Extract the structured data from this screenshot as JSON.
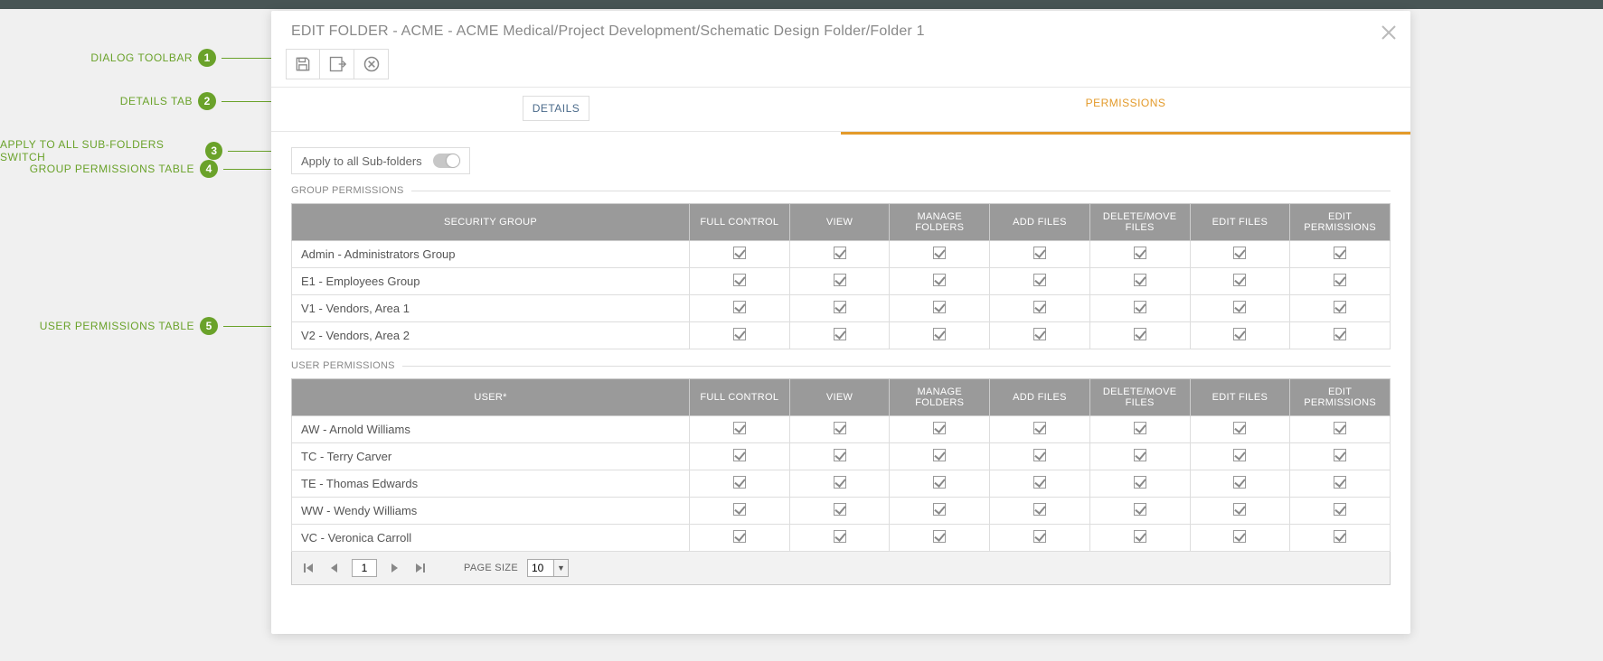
{
  "dialog": {
    "title": "EDIT FOLDER - ACME - ACME Medical/Project Development/Schematic Design Folder/Folder 1"
  },
  "tabs": {
    "details": "DETAILS",
    "permissions": "PERMISSIONS"
  },
  "apply_label": "Apply to all Sub-folders",
  "apply_value": false,
  "group_section": {
    "title": "GROUP PERMISSIONS",
    "name_col": "SECURITY GROUP"
  },
  "user_section": {
    "title": "USER PERMISSIONS",
    "name_col": "USER*"
  },
  "columns": {
    "full": "FULL CONTROL",
    "view": "VIEW",
    "manage": "MANAGE FOLDERS",
    "add": "ADD FILES",
    "del": "DELETE/MOVE FILES",
    "edit": "EDIT FILES",
    "perm": "EDIT PERMISSIONS"
  },
  "groups": [
    {
      "name": "Admin - Administrators Group",
      "full": true,
      "view": true,
      "manage": true,
      "add": true,
      "del": true,
      "edit": true,
      "perm": true
    },
    {
      "name": "E1 - Employees Group",
      "full": true,
      "view": true,
      "manage": true,
      "add": true,
      "del": true,
      "edit": true,
      "perm": true
    },
    {
      "name": "V1 - Vendors, Area 1",
      "full": true,
      "view": true,
      "manage": true,
      "add": true,
      "del": true,
      "edit": true,
      "perm": true
    },
    {
      "name": "V2 - Vendors, Area 2",
      "full": true,
      "view": true,
      "manage": true,
      "add": true,
      "del": true,
      "edit": true,
      "perm": true
    }
  ],
  "users": [
    {
      "name": "AW - Arnold Williams",
      "full": true,
      "view": true,
      "manage": true,
      "add": true,
      "del": true,
      "edit": true,
      "perm": true
    },
    {
      "name": "TC - Terry Carver",
      "full": true,
      "view": true,
      "manage": true,
      "add": true,
      "del": true,
      "edit": true,
      "perm": true
    },
    {
      "name": "TE - Thomas Edwards",
      "full": true,
      "view": true,
      "manage": true,
      "add": true,
      "del": true,
      "edit": true,
      "perm": true
    },
    {
      "name": "WW - Wendy Williams",
      "full": true,
      "view": true,
      "manage": true,
      "add": true,
      "del": true,
      "edit": true,
      "perm": true
    },
    {
      "name": "VC - Veronica Carroll",
      "full": true,
      "view": true,
      "manage": true,
      "add": true,
      "del": true,
      "edit": true,
      "perm": true
    }
  ],
  "paginator": {
    "page": "1",
    "page_size_label": "PAGE SIZE",
    "page_size": "10"
  },
  "callouts": [
    {
      "num": "1",
      "label": "DIALOG TOOLBAR"
    },
    {
      "num": "2",
      "label": "DETAILS TAB"
    },
    {
      "num": "3",
      "label": "APPLY TO ALL SUB-FOLDERS SWITCH"
    },
    {
      "num": "4",
      "label": "GROUP PERMISSIONS TABLE"
    },
    {
      "num": "5",
      "label": "USER PERMISSIONS TABLE"
    }
  ]
}
